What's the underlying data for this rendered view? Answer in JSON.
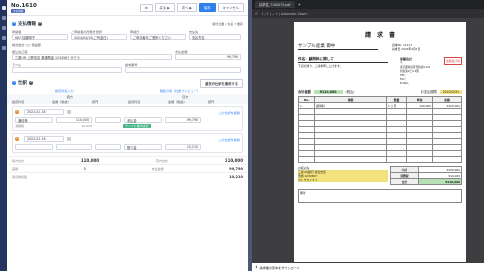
{
  "header": {
    "number": "No.1610",
    "badge": "支払依頼",
    "btn_copy": "⧉",
    "btn_back": "戻る ▶",
    "btn_next": "次へ ▶",
    "btn_save": "保存",
    "btn_cancel": "キャンセル"
  },
  "basic": {
    "title": "支払情報",
    "help": "?",
    "meta": "添付文書 / 支払 ▾ 既存",
    "applicant_label": "申請者",
    "applicant_value": "087:加藤明子",
    "applicant_sub": "ご申請者の所属を選択",
    "date_label": "申請日",
    "date_value": "2024/04/15(ご代金日)",
    "payee_label": "支払先",
    "payee_value": "ご申請者をご選択ください",
    "payee_company_label": "支払先名",
    "payee_company_value": "株式会社 ○○ 建設部",
    "bank_label": "振込先口座",
    "bank_value": "三菱UFJ 上野支店 普通預金 1234567 サクラ",
    "total_label": "支払金額",
    "total_value": "99,790",
    "memo_label": "ラベル",
    "memo2_label": "請求番号",
    "req_link": "取引先マスタから選択"
  },
  "detail": {
    "title": "仕訳",
    "help": "?",
    "link_top": "過去の仕訳を適用する",
    "toggle_left": "勘定科目入力",
    "toggle_right": "税区分別（仕訳プレビュー）",
    "col1": "借方",
    "col2": "貸方",
    "h_acct": "勘定科目",
    "h_amount": "金額（税抜）",
    "h_dept": "部門",
    "h_acct2": "勘定科目",
    "h_amount2": "金額（税抜）",
    "h_dept2": "部門",
    "rows": [
      {
        "no": "1",
        "date": "2022-01-16",
        "acct": "通信費",
        "amt": "110,000",
        "tax": "10,000",
        "cacct": "未払金",
        "camt": "99,790",
        "grn": "サンプル株式会社",
        "tax_label": "消費税",
        "link": "この仕訳を削除"
      },
      {
        "no": "2",
        "date": "2022-01-16",
        "acct": "",
        "amt": "",
        "tax": "",
        "cacct": "預り金",
        "camt": "10,210",
        "grn": "",
        "tax_label": "",
        "link": "この仕訳を削除"
      }
    ],
    "tot_label": "借方合計",
    "tot_value": "110,000",
    "tot_sub": "(10,000)",
    "cr_label": "貸方合計",
    "cr_value": "110,000",
    "diff_label": "差額",
    "diff_value": "0",
    "pay_label": "支払金額",
    "pay_value": "99,790",
    "res_label": "源泉徴収税",
    "res_value": "10,210"
  },
  "pdf": {
    "tab": "請求書_7100075.pdf",
    "toolbar": "1 / 1 | − + | Automatic Zoom ⁝",
    "title": "請　求　書",
    "company": "サンプル産業",
    "honorific": "御中",
    "invoice_no_label": "請求No.",
    "invoice_no": "11111",
    "date_label": "請求日",
    "date": "2022年4月1日",
    "subject": "件名：顧問料に関して",
    "greeting": "下記の通り、ご請求申し上げます。",
    "issuer": "加藤会計",
    "addr1": "〒",
    "addr2": "東京都新宿区西新宿0-0-0",
    "addr3": "新宿第1ビル3階",
    "tel": "TEL：",
    "fax": "FAX：",
    "mail": "E-Mail：",
    "total_label": "合計金額",
    "total_value": "¥110,000",
    "tax_note": "(税込)",
    "due_label": "お支払期限",
    "due_value": "2022/5/31",
    "th": [
      "No.",
      "摘要",
      "数量",
      "単価",
      "金額"
    ],
    "item": {
      "no": "1",
      "desc": "顧問料",
      "qty": "1 ヶ月",
      "unit": "100,000",
      "amount": "¥100,000"
    },
    "sub_label": "小計",
    "sub_value": "¥100,000",
    "tax_label": "消費税",
    "tax_value": "¥10,000",
    "grand_label": "合計",
    "grand_value": "¥110,000",
    "bank": "お振込先",
    "bank1": "三菱UFJ銀行 新宿支店",
    "bank2": "普通 1234567",
    "bank3": "カトウカイケイ",
    "remark": "備考",
    "stamp": "加藤会計印",
    "bottom": "請求書の原本をダウンロード"
  }
}
